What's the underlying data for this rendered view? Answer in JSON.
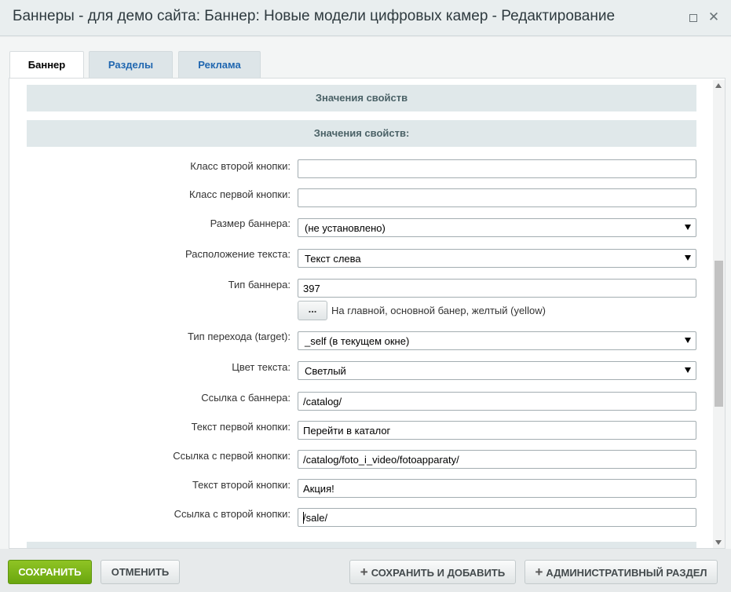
{
  "window": {
    "title": "Баннеры - для демо сайта: Баннер: Новые модели цифровых камер - Редактирование",
    "maximize_icon": "maximize-icon",
    "close_glyph": "✕"
  },
  "tabs": [
    {
      "label": "Баннер",
      "active": true
    },
    {
      "label": "Разделы",
      "active": false
    },
    {
      "label": "Реклама",
      "active": false
    }
  ],
  "sections": {
    "header_1": "Значения свойств",
    "header_2": "Значения свойств:"
  },
  "form": {
    "second_btn_class": {
      "label": "Класс второй кнопки:",
      "value": ""
    },
    "first_btn_class": {
      "label": "Класс первой кнопки:",
      "value": ""
    },
    "banner_size": {
      "label": "Размер баннера:",
      "value": "(не установлено)"
    },
    "text_position": {
      "label": "Расположение текста:",
      "value": "Текст слева"
    },
    "banner_type": {
      "label": "Тип баннера:",
      "value": "397",
      "button": "...",
      "hint": "На главной, основной банер, желтый (yellow)"
    },
    "target": {
      "label": "Тип перехода (target):",
      "value": "_self (в текущем окне)"
    },
    "text_color": {
      "label": "Цвет текста:",
      "value": "Светлый"
    },
    "banner_link": {
      "label": "Ссылка с баннера:",
      "value": "/catalog/"
    },
    "first_btn_text": {
      "label": "Текст первой кнопки:",
      "value": "Перейти в каталог"
    },
    "first_btn_link": {
      "label": "Ссылка с первой кнопки:",
      "value": "/catalog/foto_i_video/fotoapparaty/"
    },
    "second_btn_text": {
      "label": "Текст второй кнопки:",
      "value": "Акция!"
    },
    "second_btn_link": {
      "label": "Ссылка с второй кнопки:",
      "value": "/sale/"
    }
  },
  "footer": {
    "save": "СОХРАНИТЬ",
    "cancel": "ОТМЕНИТЬ",
    "save_add": "СОХРАНИТЬ И ДОБАВИТЬ",
    "admin": "АДМИНИСТРАТИВНЫЙ РАЗДЕЛ",
    "plus_glyph": "+"
  },
  "colors": {
    "save_button": "#7ab51d",
    "tab_link": "#2067b0",
    "section_header_bg": "#e0e8ea"
  }
}
